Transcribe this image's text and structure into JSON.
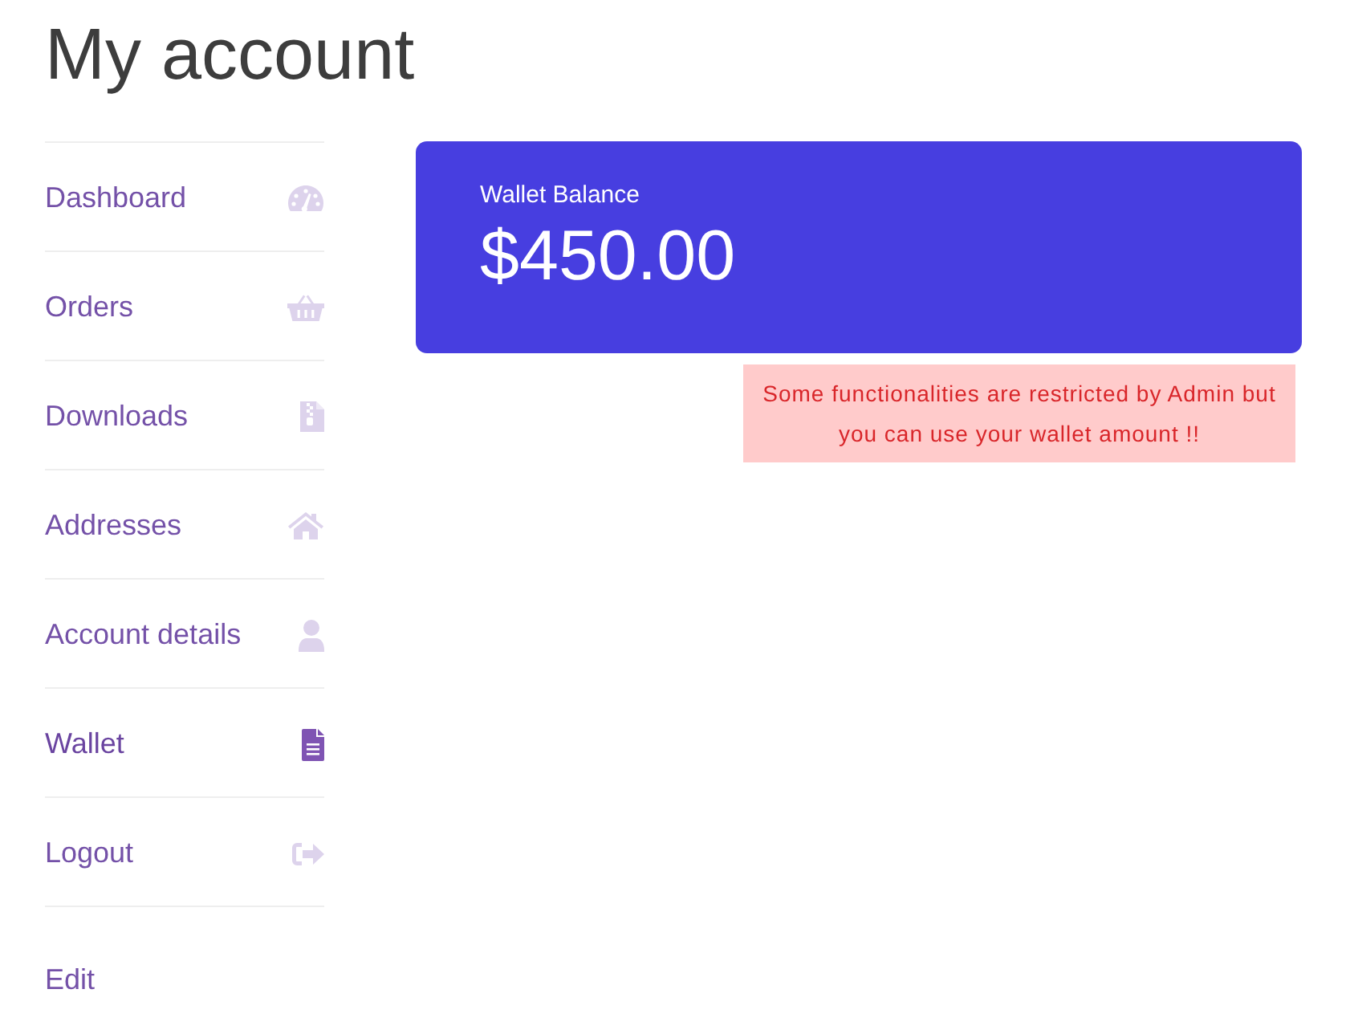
{
  "page": {
    "title": "My account"
  },
  "navigation": {
    "items": [
      {
        "label": "Dashboard",
        "selected": false
      },
      {
        "label": "Orders",
        "selected": false
      },
      {
        "label": "Downloads",
        "selected": false
      },
      {
        "label": "Addresses",
        "selected": false
      },
      {
        "label": "Account details",
        "selected": false
      },
      {
        "label": "Wallet",
        "selected": true
      },
      {
        "label": "Logout",
        "selected": false
      }
    ]
  },
  "edit_link": {
    "label": "Edit"
  },
  "wallet_card": {
    "label": "Wallet Balance",
    "amount": "$450.00"
  },
  "notice": {
    "text": "Some functionalities are restricted by Admin but you can use your wallet amount !!"
  }
}
